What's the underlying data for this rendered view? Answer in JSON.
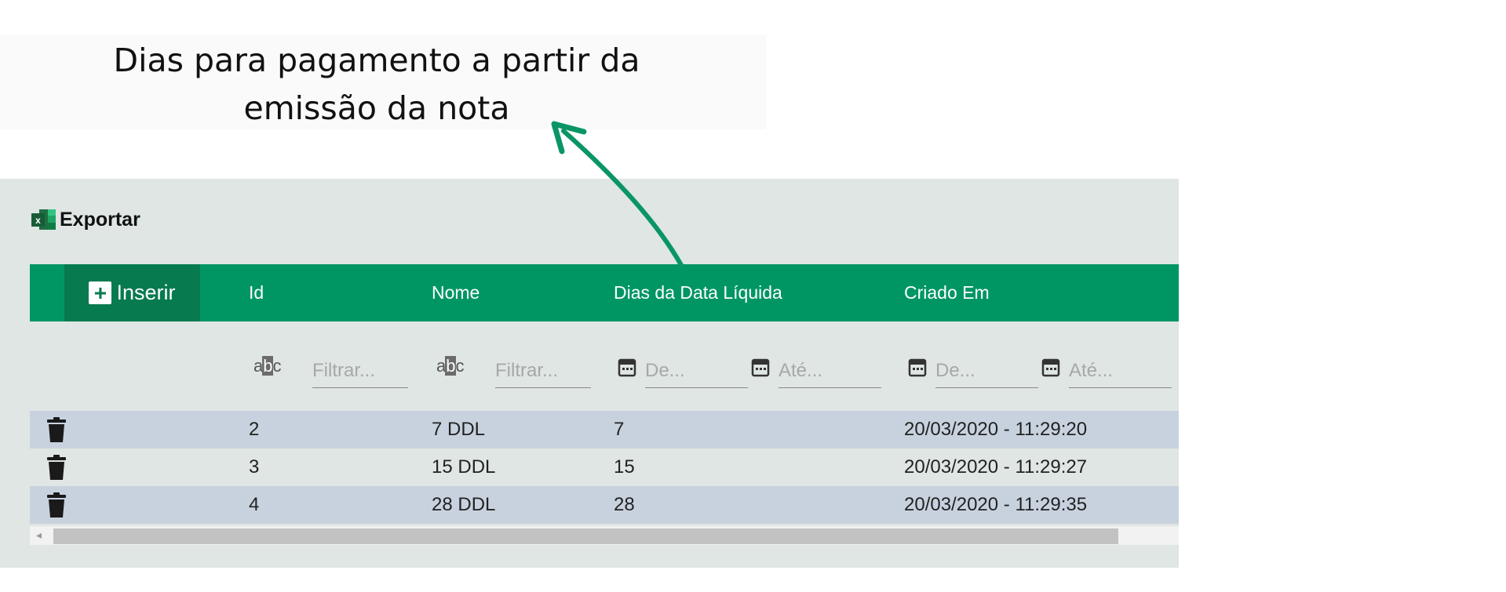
{
  "annotation": {
    "line1": "Dias para pagamento a partir da",
    "line2": "emissão da nota"
  },
  "toolbar": {
    "export_label": "Exportar",
    "export_icon": "excel-icon"
  },
  "grid": {
    "insert_label": "Inserir",
    "columns": [
      "Id",
      "Nome",
      "Dias da Data Líquida",
      "Criado Em"
    ],
    "filters": {
      "id_placeholder": "Filtrar...",
      "nome_placeholder": "Filtrar...",
      "dias_from_placeholder": "De...",
      "dias_to_placeholder": "Até...",
      "criado_from_placeholder": "De...",
      "criado_to_placeholder": "Até..."
    },
    "rows": [
      {
        "id": "2",
        "nome": "7 DDL",
        "dias": "7",
        "criado": "20/03/2020 - 11:29:20"
      },
      {
        "id": "3",
        "nome": "15 DDL",
        "dias": "15",
        "criado": "20/03/2020 - 11:29:27"
      },
      {
        "id": "4",
        "nome": "28 DDL",
        "dias": "28",
        "criado": "20/03/2020 - 11:29:35"
      }
    ]
  },
  "colors": {
    "header": "#009664",
    "insert_button": "#077a4f",
    "row_alt": "#c8d2df",
    "panel": "#dfe6e3",
    "arrow": "#0a9564"
  }
}
